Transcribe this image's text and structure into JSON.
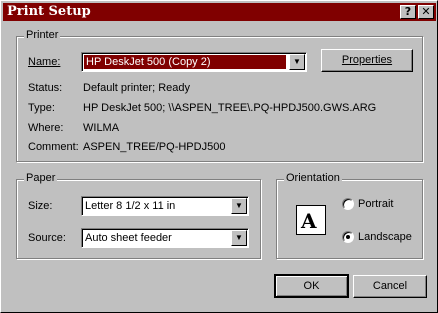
{
  "window": {
    "title": "Print Setup",
    "help_button": "?",
    "close_button": "✕"
  },
  "printer": {
    "group_label": "Printer",
    "name_label": "Name:",
    "name_value": "HP DeskJet 500 (Copy 2)",
    "properties_button": "Properties",
    "status_label": "Status:",
    "status_value": "Default printer; Ready",
    "type_label": "Type:",
    "type_value": "HP DeskJet 500; \\\\ASPEN_TREE\\.PQ-HPDJ500.GWS.ARG",
    "where_label": "Where:",
    "where_value": "WILMA",
    "comment_label": "Comment:",
    "comment_value": "ASPEN_TREE/PQ-HPDJ500"
  },
  "paper": {
    "group_label": "Paper",
    "size_label": "Size:",
    "size_value": "Letter 8 1/2 x 11 in",
    "source_label": "Source:",
    "source_value": "Auto sheet feeder"
  },
  "orientation": {
    "group_label": "Orientation",
    "icon_letter": "A",
    "portrait_label": "Portrait",
    "landscape_label": "Landscape",
    "selected": "Landscape"
  },
  "actions": {
    "ok_label": "OK",
    "cancel_label": "Cancel"
  }
}
